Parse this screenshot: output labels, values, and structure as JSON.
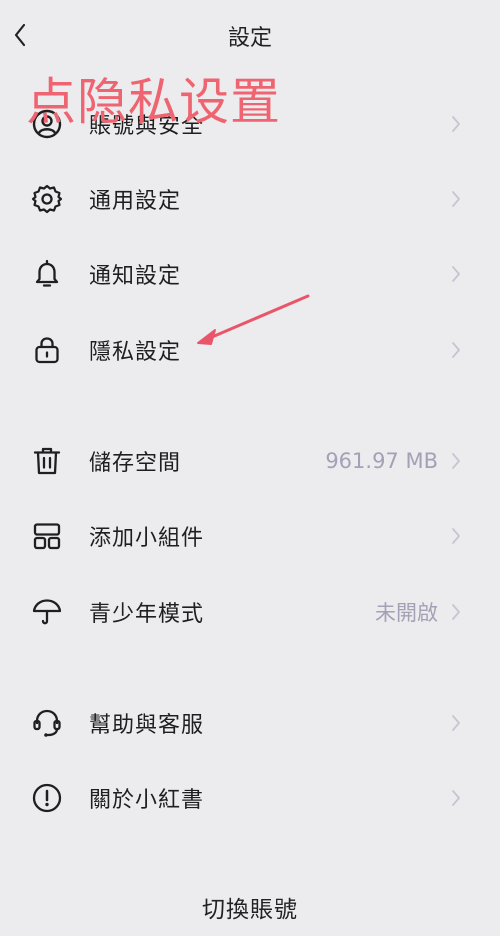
{
  "header": {
    "title": "設定"
  },
  "annotation": {
    "text": "点隐私设置"
  },
  "groups": [
    {
      "items": [
        {
          "label": "賬號與安全",
          "value": ""
        },
        {
          "label": "通用設定",
          "value": ""
        },
        {
          "label": "通知設定",
          "value": ""
        },
        {
          "label": "隱私設定",
          "value": ""
        }
      ]
    },
    {
      "items": [
        {
          "label": "儲存空間",
          "value": "961.97 MB"
        },
        {
          "label": "添加小組件",
          "value": ""
        },
        {
          "label": "青少年模式",
          "value": "未開啟"
        }
      ]
    },
    {
      "items": [
        {
          "label": "幫助與客服",
          "value": ""
        },
        {
          "label": "關於小紅書",
          "value": ""
        }
      ]
    }
  ],
  "footer": {
    "switch_account": "切換賬號"
  },
  "colors": {
    "background": "#ececee",
    "annotation": "#ee6470",
    "muted": "#a3a1b5",
    "chevron": "#c6c5d2"
  }
}
